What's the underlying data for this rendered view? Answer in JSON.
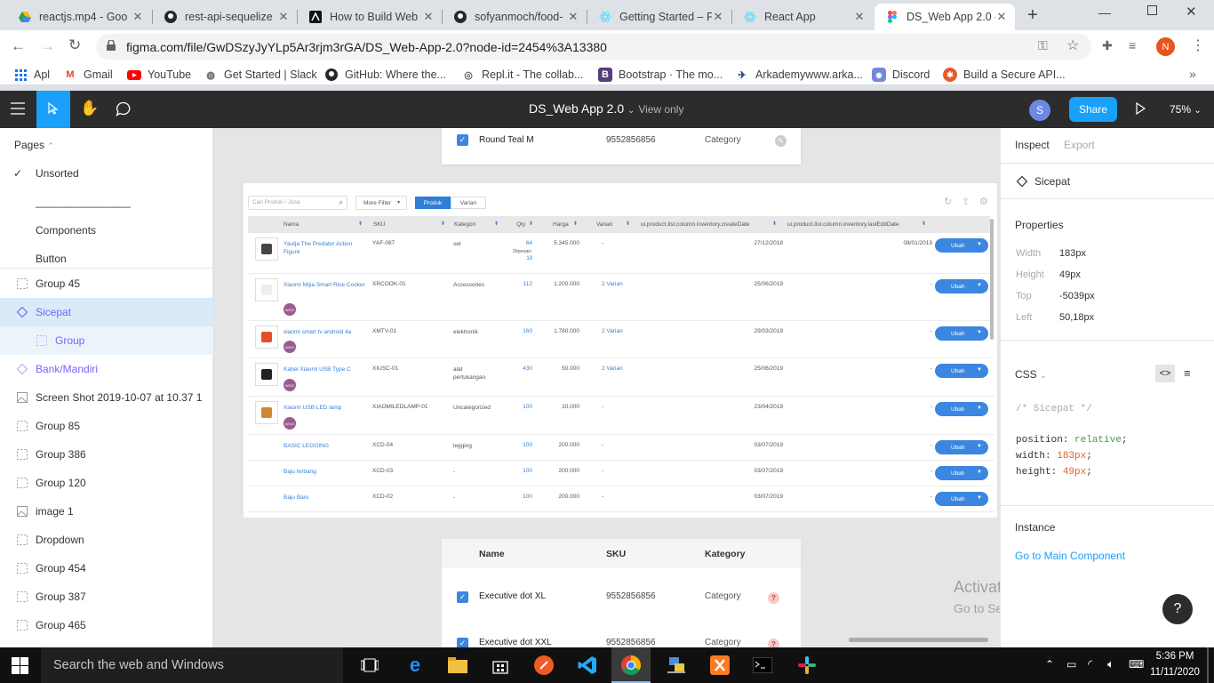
{
  "browser": {
    "tabs": [
      {
        "title": "reactjs.mp4 - Goo",
        "icon": "google-drive-icon"
      },
      {
        "title": "rest-api-sequelize",
        "icon": "github-icon"
      },
      {
        "title": "How to Build Web",
        "icon": "adonis-icon"
      },
      {
        "title": "sofyanmoch/food-",
        "icon": "github-icon"
      },
      {
        "title": "Getting Started – F",
        "icon": "react-icon"
      },
      {
        "title": "React App",
        "icon": "react-icon"
      },
      {
        "title": "DS_Web App 2.0 –",
        "icon": "figma-icon"
      }
    ],
    "new_tab": "+",
    "url": "figma.com/file/GwDSzyJyYLp5Ar3rjm3rGA/DS_Web-App-2.0?node-id=2454%3A13380",
    "profile_initial": "N",
    "bookmarks": [
      {
        "label": "Apl",
        "icon": "apps-grid-icon"
      },
      {
        "label": "Gmail",
        "icon": "gmail-icon"
      },
      {
        "label": "YouTube",
        "icon": "youtube-icon"
      },
      {
        "label": "Get Started | Slack",
        "icon": "globe-icon"
      },
      {
        "label": "GitHub: Where the...",
        "icon": "github-icon"
      },
      {
        "label": "Repl.it - The collab...",
        "icon": "replit-icon"
      },
      {
        "label": "Bootstrap · The mo...",
        "icon": "bootstrap-icon"
      },
      {
        "label": "Arkademywww.arka...",
        "icon": "arkademy-icon"
      },
      {
        "label": "Discord",
        "icon": "discord-icon"
      },
      {
        "label": "Build a Secure API...",
        "icon": "okta-icon"
      }
    ],
    "more_bookmarks": "»"
  },
  "figma": {
    "file_title": "DS_Web App 2.0",
    "view_mode": "View only",
    "user_initial": "S",
    "share_label": "Share",
    "zoom": "75%"
  },
  "left_panel": {
    "pages_label": "Pages",
    "pages": [
      "Unsorted",
      "________________",
      "Components",
      "Button"
    ],
    "layers": [
      {
        "label": "Group 45",
        "icon": "frame-dotted-icon"
      },
      {
        "label": "Sicepat",
        "icon": "component-diamond-icon"
      },
      {
        "label": "Group",
        "icon": "frame-dotted-icon"
      },
      {
        "label": "Bank/Mandiri",
        "icon": "component-diamond-icon"
      },
      {
        "label": "Screen Shot 2019-10-07 at 10.37 1",
        "icon": "image-icon"
      },
      {
        "label": "Group 85",
        "icon": "frame-dotted-icon"
      },
      {
        "label": "Group 386",
        "icon": "frame-dotted-icon"
      },
      {
        "label": "Group 120",
        "icon": "frame-dotted-icon"
      },
      {
        "label": "image 1",
        "icon": "image-icon"
      },
      {
        "label": "Dropdown",
        "icon": "frame-dotted-icon"
      },
      {
        "label": "Group 454",
        "icon": "frame-dotted-icon"
      },
      {
        "label": "Group 387",
        "icon": "frame-dotted-icon"
      },
      {
        "label": "Group 465",
        "icon": "frame-dotted-icon"
      }
    ]
  },
  "canvas": {
    "top_card": {
      "name": "Round Teal M",
      "sku": "9552856856",
      "category": "Category"
    },
    "product_table": {
      "search_placeholder": "Cari Produk / Jasa",
      "more_filter": "More Filter",
      "toggle": [
        "Produk",
        "Varian"
      ],
      "headers": [
        "Nama",
        "SKU",
        "Kategori",
        "Qty",
        "Harga",
        "Varian",
        "ui.product.list.column.inventory.createDate",
        "ui.product.list.column.inventory.lastEditDate"
      ],
      "rows": [
        {
          "name": "Yautja The Predator Action Figure",
          "sku": "YAF-067",
          "category": "set",
          "qty": "64",
          "qty_note": "Dipesan:",
          "qty_note_val": "18",
          "price": "5.345.000",
          "variant": "-",
          "created": "27/12/2018",
          "edited": "08/01/2019",
          "woo": false,
          "thumb": "figure"
        },
        {
          "name": "Xiaomi Mijia Smart Rice Cooker",
          "sku": "XRCOOK-01",
          "category": "Accessories",
          "qty": "112",
          "price": "1.200.000",
          "variant": "2 Varian",
          "created": "25/06/2019",
          "edited": "-",
          "woo": true,
          "thumb": "cooker"
        },
        {
          "name": "xiaomi smart tv android 4a",
          "sku": "XMTV-01",
          "category": "elektronik",
          "qty": "160",
          "price": "1.780.000",
          "variant": "2 Varian",
          "created": "29/03/2019",
          "edited": "-",
          "woo": true,
          "thumb": "tv"
        },
        {
          "name": "Kabel Xiaomi USB Type C",
          "sku": "XIUSC-01",
          "category": "alat pertukangan",
          "qty": "430",
          "price": "50.000",
          "variant": "2 Varian",
          "created": "25/06/2019",
          "edited": "-",
          "woo": true,
          "thumb": "cable"
        },
        {
          "name": "Xiaomi USB LED lamp",
          "sku": "XIAOMILEDLAMP-01",
          "category": "Uncategorized",
          "qty": "100",
          "price": "10.000",
          "variant": "-",
          "created": "23/04/2019",
          "edited": "-",
          "woo": true,
          "thumb": "lamp"
        },
        {
          "name": "BASIC LEGGING",
          "sku": "XCD-04",
          "category": "legging",
          "qty": "100",
          "price": "200.000",
          "variant": "-",
          "created": "03/07/2019",
          "edited": "-",
          "woo": false,
          "thumb": ""
        },
        {
          "name": "Baju terbang",
          "sku": "XCD-03",
          "category": "-",
          "qty": "100",
          "price": "200.000",
          "variant": "-",
          "created": "03/07/2019",
          "edited": "-",
          "woo": false,
          "thumb": ""
        },
        {
          "name": "Baju Baru",
          "sku": "XCD-02",
          "category": "-",
          "qty": "100",
          "price": "200.000",
          "variant": "-",
          "created": "03/07/2019",
          "edited": "-",
          "woo": false,
          "thumb": ""
        }
      ],
      "action_label": "Ubah",
      "woo_label": "WOO"
    },
    "bottom_card": {
      "headers": [
        "Name",
        "SKU",
        "Kategory"
      ],
      "rows": [
        {
          "name": "Executive dot XL",
          "sku": "9552856856",
          "category": "Category"
        },
        {
          "name": "Executive dot  XXL",
          "sku": "9552856856",
          "category": "Category"
        }
      ]
    },
    "watermark_title": "Activate Windows",
    "watermark_sub": "Go to Settings to activate Windows."
  },
  "right_panel": {
    "tabs": [
      "Inspect",
      "Export"
    ],
    "selected_name": "Sicepat",
    "properties_label": "Properties",
    "properties": [
      {
        "label": "Width",
        "value": "183px"
      },
      {
        "label": "Height",
        "value": "49px"
      },
      {
        "label": "Top",
        "value": "-5039px"
      },
      {
        "label": "Left",
        "value": "50,18px"
      }
    ],
    "css_label": "CSS",
    "css_comment": "/* Sicepat */",
    "css_lines": [
      {
        "prop": "position",
        "value": "relative"
      },
      {
        "prop": "width",
        "value": "183px"
      },
      {
        "prop": "height",
        "value": "49px"
      }
    ],
    "instance_label": "Instance",
    "main_component_link": "Go to Main Component",
    "help": "?"
  },
  "taskbar": {
    "search_placeholder": "Search the web and Windows",
    "time": "5:36 PM",
    "date": "11/11/2020"
  }
}
